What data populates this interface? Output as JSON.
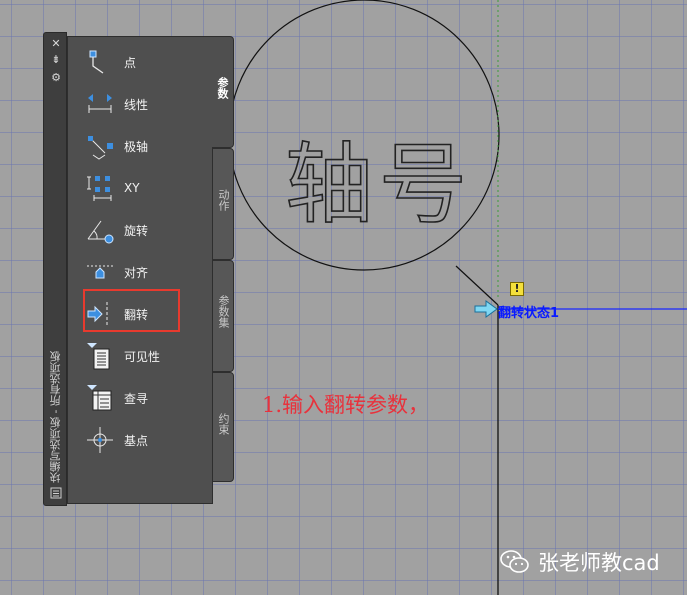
{
  "canvas": {
    "circle_text": "轴号",
    "annotation": "1.输入翻转参数，",
    "flip_parameter_label": "翻转状态1",
    "warning_glyph": "!",
    "colors": {
      "background": "#a1a1a1",
      "grid": "#6e78af",
      "annotation": "#e8323c",
      "parameter_text": "#0a1bff",
      "grip": "#7fd7f2"
    }
  },
  "palette": {
    "title": "块编写选项板 - 所有选项板",
    "title_buttons": [
      "✕",
      "⇟",
      "⚙"
    ],
    "tabs": [
      {
        "label": "参数",
        "active": true
      },
      {
        "label": "动作",
        "active": false
      },
      {
        "label": "参数集",
        "active": false
      },
      {
        "label": "约束",
        "active": false
      }
    ],
    "items": [
      {
        "label": "点",
        "icon": "point-parameter-icon"
      },
      {
        "label": "线性",
        "icon": "linear-parameter-icon"
      },
      {
        "label": "极轴",
        "icon": "polar-parameter-icon"
      },
      {
        "label": "XY",
        "icon": "xy-parameter-icon"
      },
      {
        "label": "旋转",
        "icon": "rotation-parameter-icon"
      },
      {
        "label": "对齐",
        "icon": "alignment-parameter-icon"
      },
      {
        "label": "翻转",
        "icon": "flip-parameter-icon",
        "highlighted": true
      },
      {
        "label": "可见性",
        "icon": "visibility-parameter-icon"
      },
      {
        "label": "查寻",
        "icon": "lookup-parameter-icon"
      },
      {
        "label": "基点",
        "icon": "basepoint-parameter-icon"
      }
    ]
  },
  "watermark": {
    "text": "张老师教cad",
    "icon": "wechat-icon"
  }
}
